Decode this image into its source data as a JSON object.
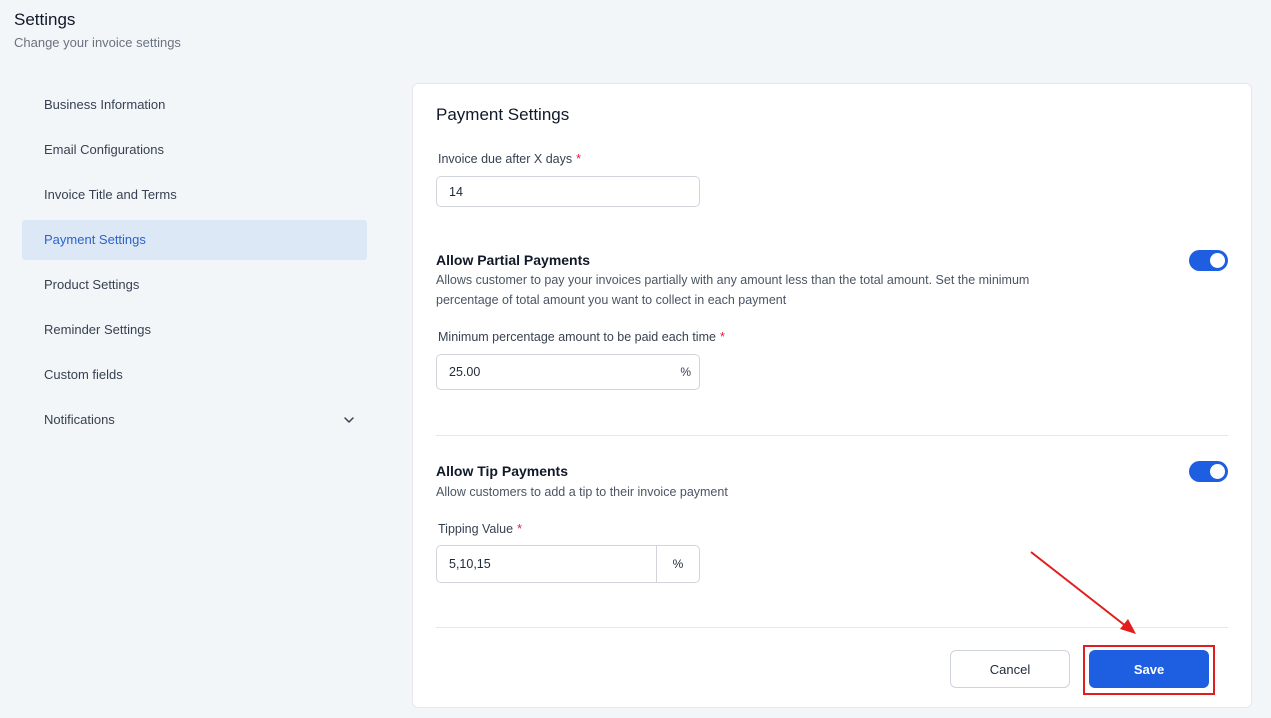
{
  "header": {
    "title": "Settings",
    "subtitle": "Change your invoice settings"
  },
  "sidebar": {
    "items": [
      {
        "label": "Business Information"
      },
      {
        "label": "Email Configurations"
      },
      {
        "label": "Invoice Title and Terms"
      },
      {
        "label": "Payment Settings",
        "active": true
      },
      {
        "label": "Product Settings"
      },
      {
        "label": "Reminder Settings"
      },
      {
        "label": "Custom fields"
      },
      {
        "label": "Notifications",
        "icon": "chevron-down-icon"
      }
    ]
  },
  "payment": {
    "title": "Payment Settings",
    "due_label": "Invoice due after X days",
    "due_value": "14",
    "required_mark": "*",
    "partial": {
      "title": "Allow Partial Payments",
      "description": "Allows customer to pay your invoices partially with any amount less than the total amount. Set the minimum percentage of total amount you want to collect in each payment",
      "enabled": true,
      "min_label": "Minimum percentage amount to be paid each time",
      "min_value": "25.00",
      "min_suffix": "%"
    },
    "tip": {
      "title": "Allow Tip Payments",
      "description": "Allow customers to add a tip to their invoice payment",
      "enabled": true,
      "value_label": "Tipping Value",
      "value": "5,10,15",
      "addon": "%"
    }
  },
  "actions": {
    "cancel_label": "Cancel",
    "save_label": "Save"
  },
  "colors": {
    "accent": "#1d5fe0",
    "highlight": "#e11d1d",
    "active_bg": "#dde8f7"
  }
}
